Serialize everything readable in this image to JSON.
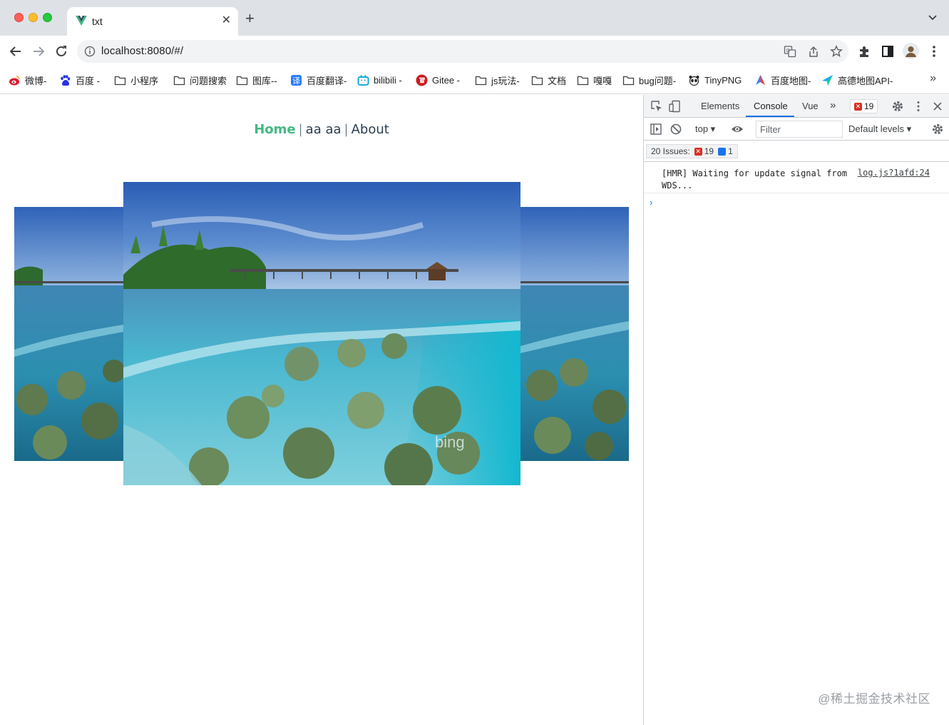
{
  "browser": {
    "tab": {
      "title": "txt",
      "favicon": "vue-logo-icon"
    },
    "address": {
      "url": "localhost:8080/#/"
    }
  },
  "bookmarks": [
    {
      "label": "微博-",
      "icon": "weibo-icon"
    },
    {
      "label": "百度 -",
      "icon": "baidu-icon"
    },
    {
      "label": "小程序",
      "icon": "folder-icon"
    },
    {
      "label": "问题搜索",
      "icon": "folder-icon"
    },
    {
      "label": "图库--",
      "icon": "folder-icon"
    },
    {
      "label": "百度翻译-",
      "icon": "baidu-translate-icon"
    },
    {
      "label": "bilibili -",
      "icon": "bilibili-icon"
    },
    {
      "label": "Gitee -",
      "icon": "gitee-icon"
    },
    {
      "label": "js玩法-",
      "icon": "folder-icon"
    },
    {
      "label": "文档",
      "icon": "folder-icon"
    },
    {
      "label": "嘎嘎",
      "icon": "folder-icon"
    },
    {
      "label": "bug问题-",
      "icon": "folder-icon"
    },
    {
      "label": "TinyPNG",
      "icon": "tinypng-icon"
    },
    {
      "label": "百度地图-",
      "icon": "baidu-map-icon"
    },
    {
      "label": "高德地图API-",
      "icon": "amap-icon"
    }
  ],
  "bookmarks_more": "»",
  "page": {
    "nav": {
      "home": "Home",
      "sep": "|",
      "middle": "aa aa",
      "about": "About"
    },
    "carousel": {
      "watermark": "bing"
    }
  },
  "devtools": {
    "tabs": [
      "Elements",
      "Console",
      "Vue"
    ],
    "more_tabs": "»",
    "error_count": "19",
    "context": "top ▾",
    "filter_placeholder": "Filter",
    "levels": "Default levels ▾",
    "issues": {
      "label": "20 Issues:",
      "errors": "19",
      "info": "1"
    },
    "log": {
      "message": "[HMR] Waiting for update signal from WDS...",
      "source": "log.js?1afd:24"
    },
    "prompt": "›"
  },
  "watermark": "@稀土掘金技术社区",
  "colors": {
    "vue_green": "#42b983",
    "vue_dark": "#2c3e50",
    "tab_strip": "#dee1e6",
    "devtools_accent": "#1a73e8",
    "error_red": "#d93025"
  }
}
